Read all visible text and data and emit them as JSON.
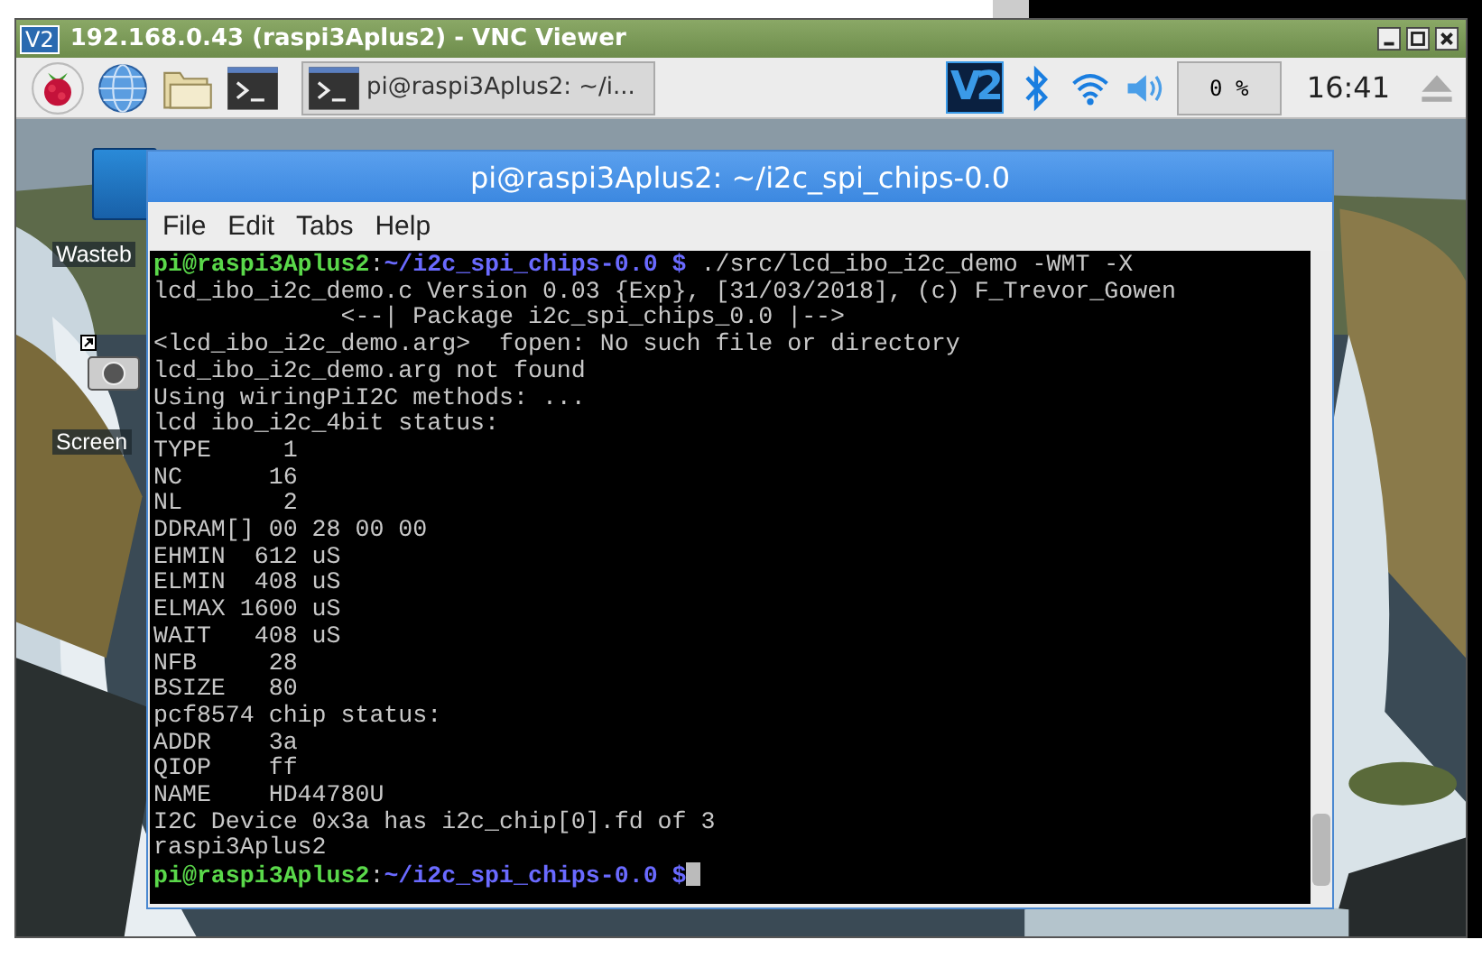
{
  "window": {
    "app_icon": "V2",
    "title": "192.168.0.43 (raspi3Aplus2) - VNC Viewer"
  },
  "taskbar": {
    "task": {
      "label": "pi@raspi3Aplus2: ~/i...",
      "selected": true
    },
    "vnc_label": "V2",
    "cpu": "0 %",
    "clock": "16:41"
  },
  "desktop": {
    "icons": [
      {
        "kind": "trash",
        "label": "Wasteb"
      },
      {
        "kind": "camera",
        "label": "Screen"
      }
    ]
  },
  "terminal": {
    "title": "pi@raspi3Aplus2: ~/i2c_spi_chips-0.0",
    "menu": [
      "File",
      "Edit",
      "Tabs",
      "Help"
    ],
    "lines": [
      {
        "kind": "prompt",
        "user": "pi@raspi3Aplus2",
        "separator": ":",
        "path": "~/i2c_spi_chips-0.0 $",
        "command": " ./src/lcd_ibo_i2c_demo -WMT -X",
        "cursor": false
      },
      {
        "kind": "output",
        "text": "lcd_ibo_i2c_demo.c Version 0.03 {Exp}, [31/03/2018], (c) F_Trevor_Gowen"
      },
      {
        "kind": "output",
        "text": "             <--| Package i2c_spi_chips_0.0 |-->"
      },
      {
        "kind": "output",
        "text": "<lcd_ibo_i2c_demo.arg>  fopen: No such file or directory"
      },
      {
        "kind": "output",
        "text": "lcd_ibo_i2c_demo.arg not found"
      },
      {
        "kind": "output",
        "text": "Using wiringPiI2C methods: ..."
      },
      {
        "kind": "output",
        "text": "lcd ibo_i2c_4bit status:"
      },
      {
        "kind": "output",
        "text": "TYPE     1"
      },
      {
        "kind": "output",
        "text": "NC      16"
      },
      {
        "kind": "output",
        "text": "NL       2"
      },
      {
        "kind": "output",
        "text": "DDRAM[] 00 28 00 00"
      },
      {
        "kind": "output",
        "text": "EHMIN  612 uS"
      },
      {
        "kind": "output",
        "text": "ELMIN  408 uS"
      },
      {
        "kind": "output",
        "text": "ELMAX 1600 uS"
      },
      {
        "kind": "output",
        "text": "WAIT   408 uS"
      },
      {
        "kind": "output",
        "text": "NFB     28"
      },
      {
        "kind": "output",
        "text": "BSIZE   80"
      },
      {
        "kind": "output",
        "text": "pcf8574 chip status:"
      },
      {
        "kind": "output",
        "text": "ADDR    3a"
      },
      {
        "kind": "output",
        "text": "QIOP    ff"
      },
      {
        "kind": "output",
        "text": "NAME    HD44780U"
      },
      {
        "kind": "output",
        "text": "I2C Device 0x3a has i2c_chip[0].fd of 3"
      },
      {
        "kind": "output",
        "text": "raspi3Aplus2"
      },
      {
        "kind": "prompt",
        "user": "pi@raspi3Aplus2",
        "separator": ":",
        "path": "~/i2c_spi_chips-0.0 $",
        "cursor": true
      }
    ]
  }
}
